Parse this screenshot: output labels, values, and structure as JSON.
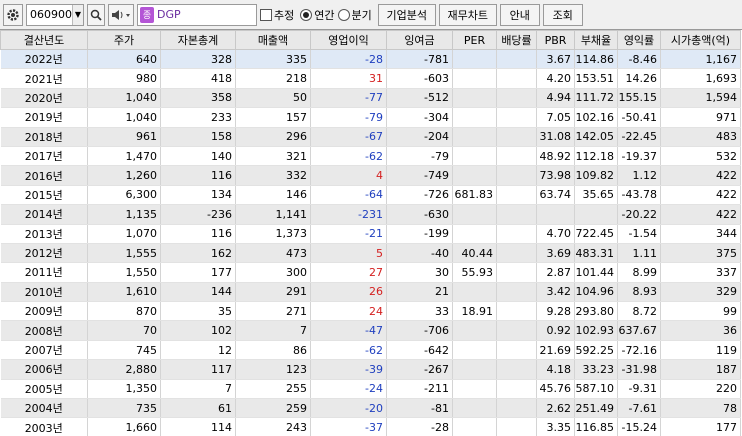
{
  "toolbar": {
    "code": "060900",
    "name": "DGP",
    "name_icon_text": "종",
    "estimate_label": "추정",
    "annual_label": "연간",
    "quarterly_label": "분기",
    "company_analysis": "기업분석",
    "financial_chart": "재무차트",
    "guide": "안내",
    "query": "조회"
  },
  "table": {
    "headers": [
      "결산년도",
      "주가",
      "자본총계",
      "매출액",
      "영업이익",
      "잉여금",
      "PER",
      "배당률",
      "PBR",
      "부채율",
      "영익률",
      "시가총액(억)"
    ],
    "rows": [
      [
        "2022년",
        "640",
        "328",
        "335",
        "-28",
        "-781",
        "",
        "",
        "3.67",
        "114.86",
        "-8.46",
        "1,167"
      ],
      [
        "2021년",
        "980",
        "418",
        "218",
        "31",
        "-603",
        "",
        "",
        "4.20",
        "153.51",
        "14.26",
        "1,693"
      ],
      [
        "2020년",
        "1,040",
        "358",
        "50",
        "-77",
        "-512",
        "",
        "",
        "4.94",
        "111.72",
        "155.15",
        "1,594"
      ],
      [
        "2019년",
        "1,040",
        "233",
        "157",
        "-79",
        "-304",
        "",
        "",
        "7.05",
        "102.16",
        "-50.41",
        "971"
      ],
      [
        "2018년",
        "961",
        "158",
        "296",
        "-67",
        "-204",
        "",
        "",
        "31.08",
        "142.05",
        "-22.45",
        "483"
      ],
      [
        "2017년",
        "1,470",
        "140",
        "321",
        "-62",
        "-79",
        "",
        "",
        "48.92",
        "112.18",
        "-19.37",
        "532"
      ],
      [
        "2016년",
        "1,260",
        "116",
        "332",
        "4",
        "-749",
        "",
        "",
        "73.98",
        "109.82",
        "1.12",
        "422"
      ],
      [
        "2015년",
        "6,300",
        "134",
        "146",
        "-64",
        "-726",
        "681.83",
        "",
        "63.74",
        "35.65",
        "-43.78",
        "422"
      ],
      [
        "2014년",
        "1,135",
        "-236",
        "1,141",
        "-231",
        "-630",
        "",
        "",
        "",
        "",
        "-20.22",
        "422"
      ],
      [
        "2013년",
        "1,070",
        "116",
        "1,373",
        "-21",
        "-199",
        "",
        "",
        "4.70",
        "722.45",
        "-1.54",
        "344"
      ],
      [
        "2012년",
        "1,555",
        "162",
        "473",
        "5",
        "-40",
        "40.44",
        "",
        "3.69",
        "483.31",
        "1.11",
        "375"
      ],
      [
        "2011년",
        "1,550",
        "177",
        "300",
        "27",
        "30",
        "55.93",
        "",
        "2.87",
        "101.44",
        "8.99",
        "337"
      ],
      [
        "2010년",
        "1,610",
        "144",
        "291",
        "26",
        "21",
        "",
        "",
        "3.42",
        "104.96",
        "8.93",
        "329"
      ],
      [
        "2009년",
        "870",
        "35",
        "271",
        "24",
        "33",
        "18.91",
        "",
        "9.28",
        "293.80",
        "8.72",
        "99"
      ],
      [
        "2008년",
        "70",
        "102",
        "7",
        "-47",
        "-706",
        "",
        "",
        "0.92",
        "102.93",
        "637.67",
        "36"
      ],
      [
        "2007년",
        "745",
        "12",
        "86",
        "-62",
        "-642",
        "",
        "",
        "21.69",
        "592.25",
        "-72.16",
        "119"
      ],
      [
        "2006년",
        "2,880",
        "117",
        "123",
        "-39",
        "-267",
        "",
        "",
        "4.18",
        "33.23",
        "-31.98",
        "187"
      ],
      [
        "2005년",
        "1,350",
        "7",
        "255",
        "-24",
        "-211",
        "",
        "",
        "45.76",
        "587.10",
        "-9.31",
        "220"
      ],
      [
        "2004년",
        "735",
        "61",
        "259",
        "-20",
        "-81",
        "",
        "",
        "2.62",
        "251.49",
        "-7.61",
        "78"
      ],
      [
        "2003년",
        "1,660",
        "114",
        "243",
        "-37",
        "-28",
        "",
        "",
        "3.35",
        "116.85",
        "-15.24",
        "177"
      ]
    ]
  },
  "colors": {
    "negative": "#1f3fbf",
    "positive": "#d42020",
    "selected_row": "#dfe9f6",
    "alt_row": "#e9e9e9"
  },
  "icons": [
    "gear-icon",
    "dropdown-icon",
    "search-icon",
    "speaker-icon",
    "stock-type-icon"
  ]
}
